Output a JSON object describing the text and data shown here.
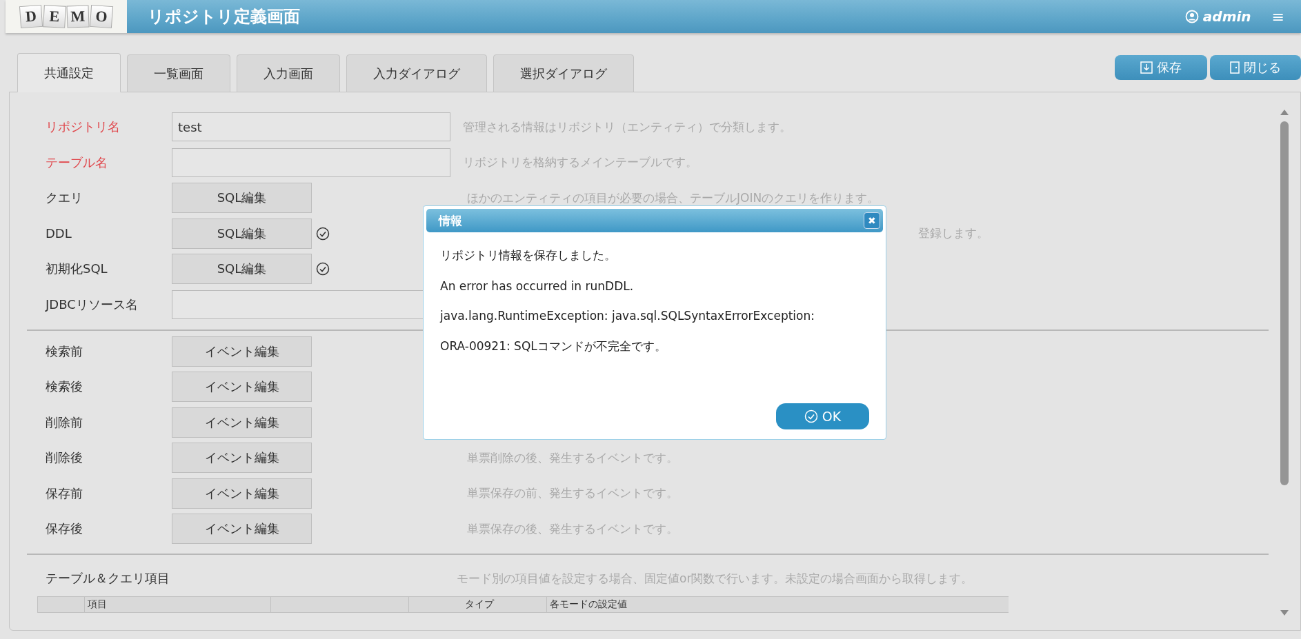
{
  "header": {
    "logo": [
      "D",
      "E",
      "M",
      "O"
    ],
    "title": "リポジトリ定義画面",
    "user": "admin",
    "menu": "≡"
  },
  "tabs": [
    {
      "label": "共通設定",
      "selected": true
    },
    {
      "label": "一覧画面",
      "selected": false
    },
    {
      "label": "入力画面",
      "selected": false
    },
    {
      "label": "入力ダイアログ",
      "selected": false
    },
    {
      "label": "選択ダイアログ",
      "selected": false
    }
  ],
  "actions": [
    {
      "label": "保存",
      "kind": "save"
    },
    {
      "label": "閉じる",
      "kind": "close"
    }
  ],
  "sections": [
    {
      "rows": [
        {
          "kind": "field",
          "label": "リポジトリ名",
          "required": true,
          "value": "test",
          "description": "管理される情報はリポジトリ（エンティティ）で分類します。"
        },
        {
          "kind": "field",
          "label": "テーブル名",
          "required": true,
          "description": "リポジトリを格納するメインテーブルです。"
        },
        {
          "kind": "button",
          "label": "クエリ",
          "required": false,
          "button": "SQL編集",
          "checked": false,
          "description": "ほかのエンティティの項目が必要の場合、テーブルJOINのクエリを作ります。"
        },
        {
          "kind": "button",
          "label": "DDL",
          "required": false,
          "button": "SQL編集",
          "checked": true,
          "description": "登録します。",
          "tail": true
        },
        {
          "kind": "button",
          "label": "初期化SQL",
          "required": false,
          "button": "SQL編集",
          "checked": true
        },
        {
          "kind": "field",
          "label": "JDBCリソース名",
          "required": false
        }
      ]
    },
    {
      "rows": [
        {
          "kind": "button",
          "label": "検索前",
          "required": false,
          "button": "イベント編集",
          "checked": false
        },
        {
          "kind": "button",
          "label": "検索後",
          "required": false,
          "button": "イベント編集",
          "checked": false
        },
        {
          "kind": "button",
          "label": "削除前",
          "required": false,
          "button": "イベント編集",
          "checked": false
        },
        {
          "kind": "button",
          "label": "削除後",
          "required": false,
          "button": "イベント編集",
          "checked": false,
          "description": "単票削除の後、発生するイベントです。"
        },
        {
          "kind": "button",
          "label": "保存前",
          "required": false,
          "button": "イベント編集",
          "checked": false,
          "description": "単票保存の前、発生するイベントです。"
        },
        {
          "kind": "button",
          "label": "保存後",
          "required": false,
          "button": "イベント編集",
          "checked": false,
          "description": "単票保存の後、発生するイベントです。"
        }
      ]
    }
  ],
  "items": {
    "title": "テーブル＆クエリ項目",
    "description": "モード別の項目値を設定する場合、固定値or関数で行います。未設定の場合画面から取得します。",
    "columns": [
      "",
      "項目",
      "",
      "タイプ",
      "各モードの設定値"
    ]
  },
  "dialog": {
    "title": "情報",
    "close": "✖",
    "messages": [
      "リポジトリ情報を保存しました。",
      "An error has occurred in runDDL.",
      "java.lang.RuntimeException: java.sql.SQLSyntaxErrorException:",
      "ORA-00921: SQLコマンドが不完全です。"
    ],
    "ok": "OK"
  }
}
